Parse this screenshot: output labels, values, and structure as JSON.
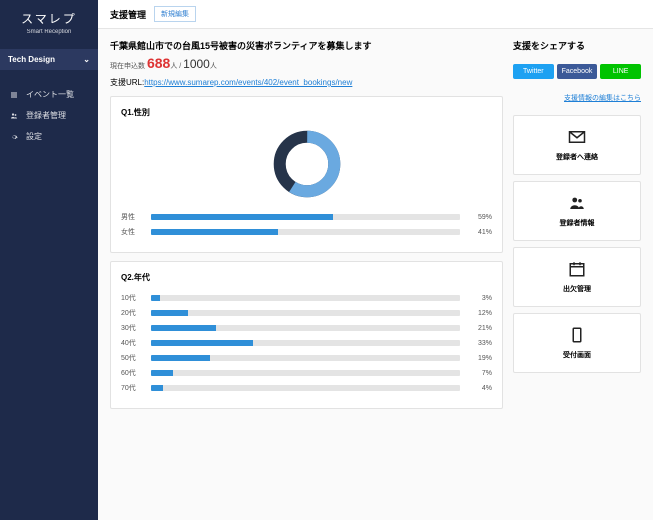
{
  "brand": {
    "title": "スマレプ",
    "subtitle": "Smart Reception"
  },
  "org": {
    "name": "Tech Design"
  },
  "nav": [
    {
      "icon": "list",
      "label": "イベント一覧"
    },
    {
      "icon": "users",
      "label": "登録者管理"
    },
    {
      "icon": "gear",
      "label": "設定"
    }
  ],
  "topbar": {
    "title": "支援管理",
    "new_label": "新規編集"
  },
  "event": {
    "title": "千葉県館山市での台風15号被害の災害ボランティアを募集します",
    "count_prefix": "現在申込数",
    "count_current": "688",
    "count_unit": "人",
    "count_sep": " / ",
    "count_max": "1000",
    "url_label": "支援URL:",
    "url": "https://www.sumarep.com/events/402/event_bookings/new"
  },
  "q1": {
    "title": "Q1.性別",
    "rows": [
      {
        "label": "男性",
        "pct": 59,
        "text": "59%"
      },
      {
        "label": "女性",
        "pct": 41,
        "text": "41%"
      }
    ]
  },
  "q2": {
    "title": "Q2.年代",
    "rows": [
      {
        "label": "10代",
        "pct": 3,
        "text": "3%"
      },
      {
        "label": "20代",
        "pct": 12,
        "text": "12%"
      },
      {
        "label": "30代",
        "pct": 21,
        "text": "21%"
      },
      {
        "label": "40代",
        "pct": 33,
        "text": "33%"
      },
      {
        "label": "50代",
        "pct": 19,
        "text": "19%"
      },
      {
        "label": "60代",
        "pct": 7,
        "text": "7%"
      },
      {
        "label": "70代",
        "pct": 4,
        "text": "4%"
      }
    ]
  },
  "share": {
    "title": "支援をシェアする",
    "twitter": "Twitter",
    "facebook": "Facebook",
    "line": "LINE",
    "edit_link": "支援情報の編集はこちら"
  },
  "actions": [
    {
      "icon": "mail",
      "label": "登録者へ連絡"
    },
    {
      "icon": "users",
      "label": "登録者情報"
    },
    {
      "icon": "calendar",
      "label": "出欠管理"
    },
    {
      "icon": "device",
      "label": "受付画面"
    }
  ],
  "chart_data": [
    {
      "type": "pie",
      "title": "Q1.性別",
      "categories": [
        "男性",
        "女性"
      ],
      "values": [
        59,
        41
      ],
      "colors": [
        "#6aa9e0",
        "#26344a"
      ]
    },
    {
      "type": "bar",
      "title": "Q1.性別",
      "categories": [
        "男性",
        "女性"
      ],
      "values": [
        59,
        41
      ],
      "xlabel": "",
      "ylabel": "%",
      "ylim": [
        0,
        100
      ]
    },
    {
      "type": "bar",
      "title": "Q2.年代",
      "categories": [
        "10代",
        "20代",
        "30代",
        "40代",
        "50代",
        "60代",
        "70代"
      ],
      "values": [
        3,
        12,
        21,
        33,
        19,
        7,
        4
      ],
      "xlabel": "",
      "ylabel": "%",
      "ylim": [
        0,
        100
      ]
    }
  ]
}
